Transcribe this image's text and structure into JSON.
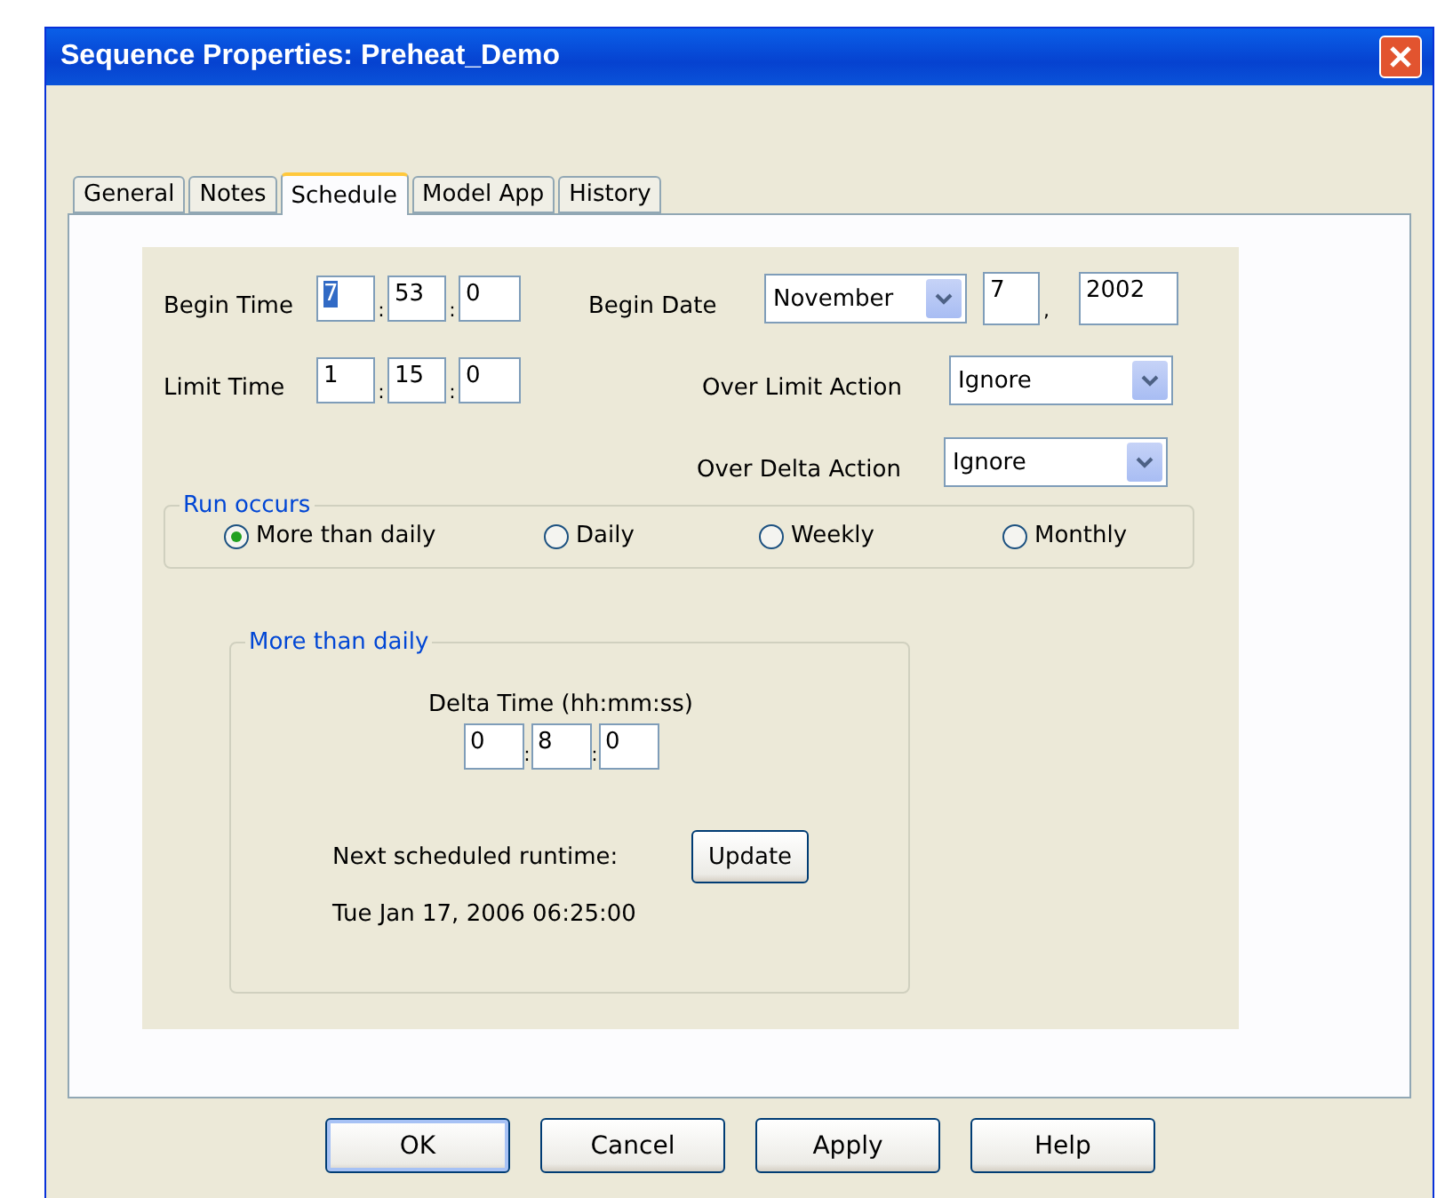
{
  "window": {
    "title": "Sequence Properties: Preheat_Demo"
  },
  "tabs": [
    {
      "label": "General",
      "selected": false
    },
    {
      "label": "Notes",
      "selected": false
    },
    {
      "label": "Schedule",
      "selected": true
    },
    {
      "label": "Model App",
      "selected": false
    },
    {
      "label": "History",
      "selected": false
    }
  ],
  "begin_time": {
    "label": "Begin Time",
    "fields": [
      {
        "value": "7",
        "highlighted": true
      },
      {
        "value": "53",
        "highlighted": false
      },
      {
        "value": "0",
        "highlighted": false
      }
    ],
    "separators": [
      ":",
      ":"
    ]
  },
  "begin_date": {
    "label": "Begin Date",
    "month": "November",
    "day": "7",
    "separator": ",",
    "year": "2002"
  },
  "limit_time": {
    "label": "Limit Time",
    "fields": [
      {
        "value": "1",
        "highlighted": false
      },
      {
        "value": "15",
        "highlighted": false
      },
      {
        "value": "0",
        "highlighted": false
      }
    ],
    "separators": [
      ":",
      ":"
    ]
  },
  "over_limit_action": {
    "label": "Over Limit Action",
    "value": "Ignore"
  },
  "over_delta_action": {
    "label": "Over Delta Action",
    "value": "Ignore"
  },
  "run_occurs": {
    "title": "Run occurs",
    "options": [
      {
        "label": "More than daily",
        "selected": true
      },
      {
        "label": "Daily",
        "selected": false
      },
      {
        "label": "Weekly",
        "selected": false
      },
      {
        "label": "Monthly",
        "selected": false
      }
    ]
  },
  "more_than_daily": {
    "title": "More than daily",
    "delta_label": "Delta Time (hh:mm:ss)",
    "delta_fields": [
      {
        "value": "0",
        "highlighted": false
      },
      {
        "value": "8",
        "highlighted": false
      },
      {
        "value": "0",
        "highlighted": false
      }
    ],
    "separators": [
      ":",
      ":"
    ],
    "next_label": "Next scheduled runtime:",
    "update_button": "Update",
    "next_runtime": "Tue Jan 17, 2006 06:25:00"
  },
  "buttons": [
    {
      "label": "OK",
      "default": true
    },
    {
      "label": "Cancel",
      "default": false
    },
    {
      "label": "Apply",
      "default": false
    },
    {
      "label": "Help",
      "default": false
    }
  ]
}
